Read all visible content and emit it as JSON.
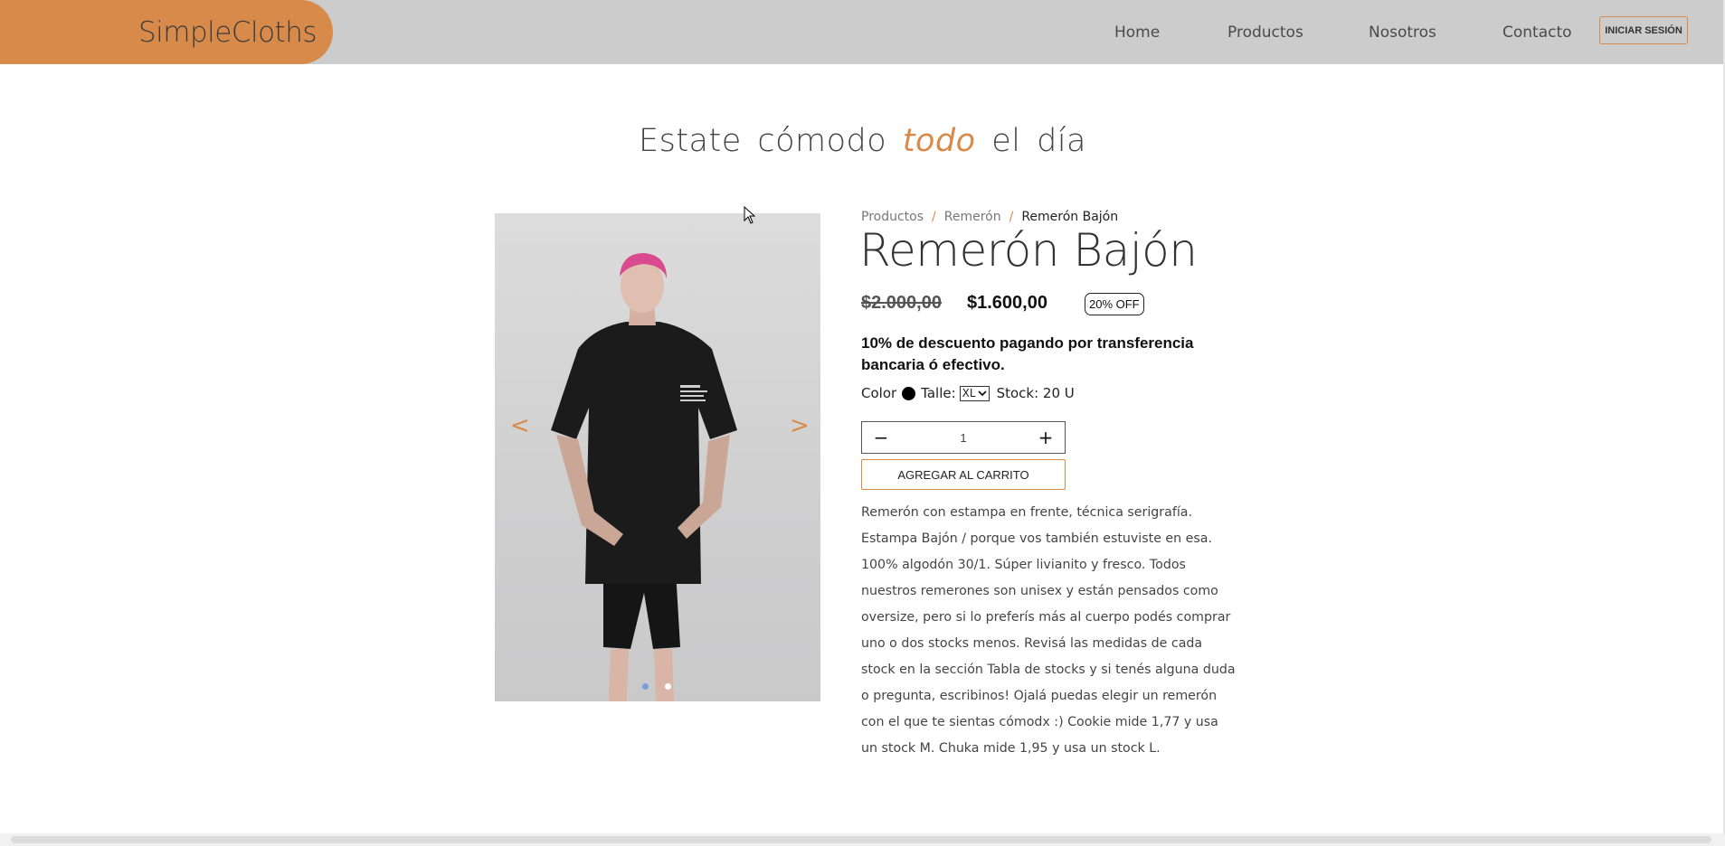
{
  "brand": {
    "name": "SimpleCloths"
  },
  "nav": {
    "items": [
      {
        "label": "Home"
      },
      {
        "label": "Productos"
      },
      {
        "label": "Nosotros"
      },
      {
        "label": "Contacto"
      }
    ],
    "login_label": "INICIAR SESIÓN"
  },
  "hero": {
    "before": "Estate cómodo",
    "accent": "todo",
    "after": "el día"
  },
  "carousel": {
    "prev": "<",
    "next": ">",
    "slide_count": 2,
    "active_slide": 1
  },
  "breadcrumb": {
    "items": [
      "Productos",
      "Remerón",
      "Remerón Bajón"
    ],
    "separator": "/"
  },
  "product": {
    "title": "Remerón Bajón",
    "old_price": "$2.000,00",
    "new_price": "$1.600,00",
    "discount_badge": "20% OFF",
    "transfer_note": "10% de descuento pagando por transferencia bancaria ó efectivo.",
    "color_label": "Color",
    "color_value": "#000000",
    "size_label": "Talle:",
    "size_value": "XL",
    "stock_label": "Stock: 20 U",
    "quantity": "1",
    "minus": "−",
    "plus": "+",
    "add_to_cart": "AGREGAR AL CARRITO",
    "description": "Remerón con estampa en frente, técnica serigrafía. Estampa Bajón / porque vos también estuviste en esa. 100% algodón 30/1. Súper livianito y fresco. Todos nuestros remerones son unisex y están pensados como oversize, pero si lo preferís más al cuerpo podés comprar uno o dos stocks menos. Revisá las medidas de cada stock en la sección Tabla de stocks y si tenés alguna duda o pregunta, escribinos! Ojalá puedas elegir un remerón con el que te sientas cómodx :) Cookie mide 1,77 y usa un stock M. Chuka mide 1,95 y usa un stock L."
  },
  "colors": {
    "accent": "#d88a4a",
    "navbar": "#cccccc",
    "dot_active": "#7a9fd8",
    "dot_inactive": "#ffffff"
  }
}
